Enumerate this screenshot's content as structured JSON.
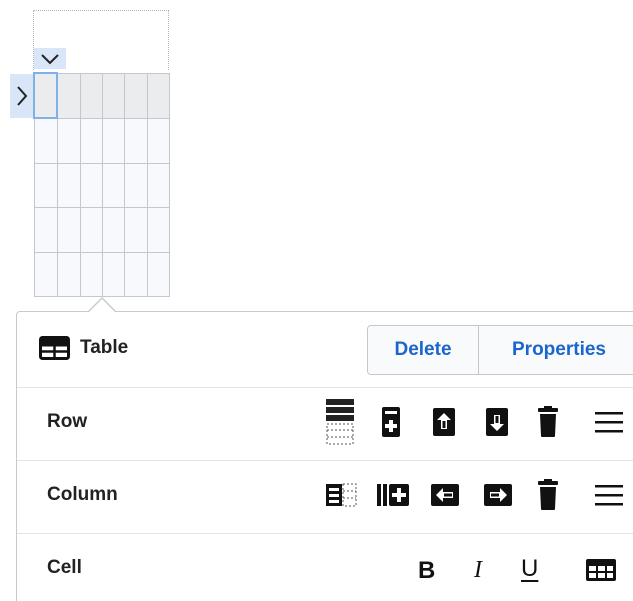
{
  "panel": {
    "title": "Table",
    "title_icon": "table-icon",
    "delete_label": "Delete",
    "properties_label": "Properties"
  },
  "rows": {
    "row_label": "Row",
    "column_label": "Column",
    "cell_label": "Cell"
  },
  "cell_format": {
    "bold": "B",
    "italic": "I",
    "underline": "U"
  },
  "icons": {
    "row": [
      "select-row-icon",
      "insert-row-icon",
      "insert-row-above-icon",
      "insert-row-below-icon",
      "delete-row-icon",
      "row-menu-icon"
    ],
    "column": [
      "select-column-icon",
      "insert-column-icon",
      "insert-column-before-icon",
      "insert-column-after-icon",
      "delete-column-icon",
      "column-menu-icon"
    ],
    "cell": [
      "bold-icon",
      "italic-icon",
      "underline-icon",
      "cell-properties-icon"
    ]
  },
  "colors": {
    "accent": "#1a66cc",
    "selection": "#d7e5f8",
    "handle": "#d9e6f7"
  }
}
